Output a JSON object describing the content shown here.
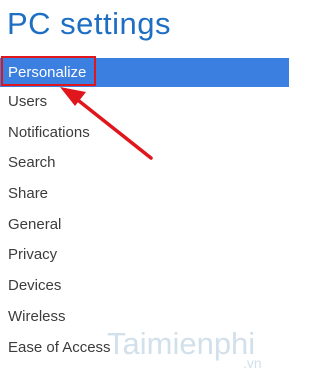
{
  "header": {
    "title": "PC settings"
  },
  "menu": {
    "items": [
      {
        "label": "Personalize",
        "selected": true
      },
      {
        "label": "Users"
      },
      {
        "label": "Notifications"
      },
      {
        "label": "Search"
      },
      {
        "label": "Share"
      },
      {
        "label": "General"
      },
      {
        "label": "Privacy"
      },
      {
        "label": "Devices"
      },
      {
        "label": "Wireless"
      },
      {
        "label": "Ease of Access"
      }
    ]
  },
  "watermark": {
    "brand": "Taimienphi",
    "suffix": ".vn"
  },
  "colors": {
    "accent": "#3b7fe0",
    "title": "#1e6fc4",
    "annotation": "#e0161c"
  }
}
